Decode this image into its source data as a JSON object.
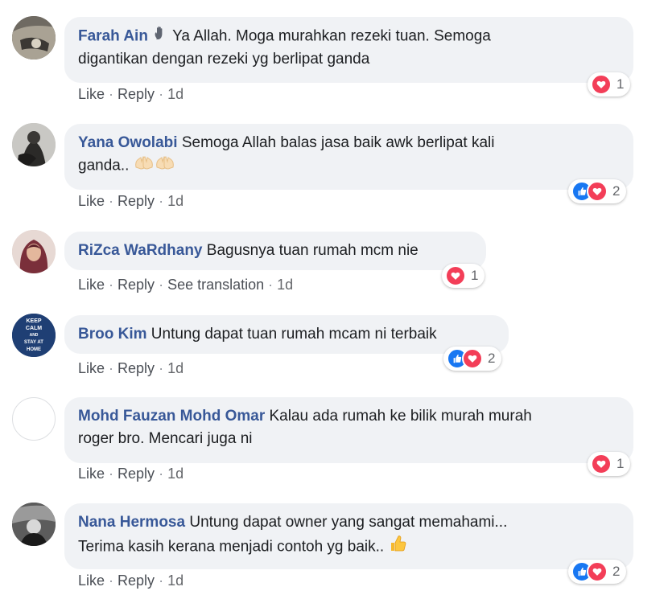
{
  "colors": {
    "author": "#385898",
    "bubble_bg": "#f0f2f5",
    "like_blue": "#1877f2",
    "love_red": "#f33e58",
    "meta_gray": "#65676b"
  },
  "actions": {
    "like": "Like",
    "reply": "Reply",
    "see_translation": "See translation",
    "separator": "·"
  },
  "comments": [
    {
      "author": "Farah Ain",
      "text_after_emoji": "Ya Allah. Moga murahkan rezeki tuan. Semoga",
      "text_line2": "digantikan dengan rezeki yg berlipat ganda",
      "emoji": "waving-hand-icon",
      "time": "1d",
      "reactions": [
        "love"
      ],
      "reaction_count": "1"
    },
    {
      "author": "Yana Owolabi",
      "text": "Semoga Allah balas jasa baik awk berlipat kali",
      "text_line2": "ganda..",
      "emoji": "raised-hands-icon",
      "time": "1d",
      "reactions": [
        "like",
        "love"
      ],
      "reaction_count": "2"
    },
    {
      "author": "RiZca WaRdhany",
      "text": "Bagusnya tuan rumah mcm nie",
      "time": "1d",
      "reactions": [
        "love"
      ],
      "reaction_count": "1"
    },
    {
      "author": "Broo Kim",
      "text": "Untung dapat tuan rumah mcam ni terbaik",
      "avatar_text": [
        "KEEP",
        "CALM",
        "AND",
        "STAY AT",
        "HOME"
      ],
      "time": "1d",
      "reactions": [
        "like",
        "love"
      ],
      "reaction_count": "2"
    },
    {
      "author": "Mohd Fauzan Mohd Omar",
      "text": "Kalau ada rumah ke bilik murah murah",
      "text_line2": "roger bro. Mencari juga ni",
      "time": "1d",
      "reactions": [
        "love"
      ],
      "reaction_count": "1"
    },
    {
      "author": "Nana Hermosa",
      "text": "Untung dapat owner yang sangat memahami...",
      "text_line2": "Terima kasih kerana menjadi contoh yg baik..",
      "emoji": "thumbs-up-icon",
      "time": "1d",
      "reactions": [
        "like",
        "love"
      ],
      "reaction_count": "2"
    }
  ]
}
